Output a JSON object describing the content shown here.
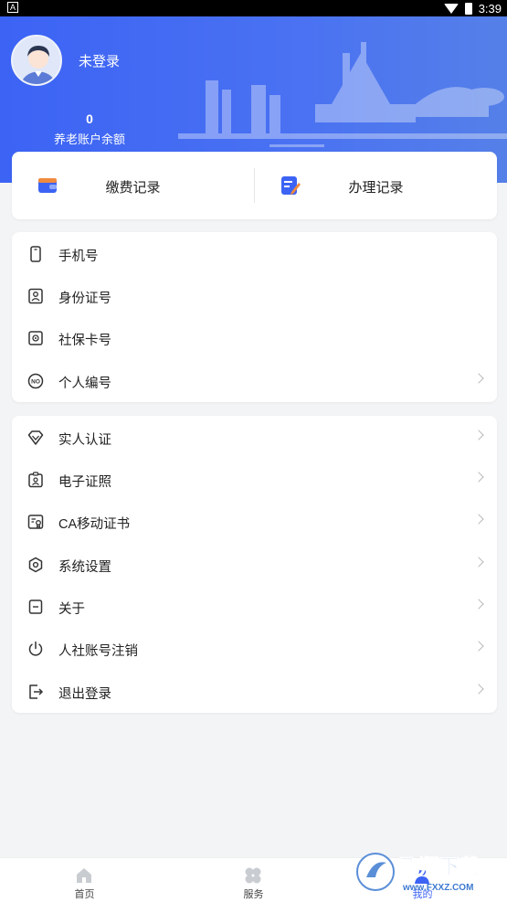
{
  "status_bar": {
    "notification_glyph": "A",
    "time": "3:39"
  },
  "profile": {
    "login_status": "未登录",
    "balance_value": "0",
    "balance_label": "养老账户余额"
  },
  "records": [
    {
      "label": "缴费记录",
      "icon": "wallet-icon"
    },
    {
      "label": "办理记录",
      "icon": "edit-document-icon"
    }
  ],
  "info_list": [
    {
      "label": "手机号",
      "icon": "phone-icon",
      "chevron": false
    },
    {
      "label": "身份证号",
      "icon": "id-card-icon",
      "chevron": false
    },
    {
      "label": "社保卡号",
      "icon": "social-card-icon",
      "chevron": false
    },
    {
      "label": "个人编号",
      "icon": "number-icon",
      "chevron": true
    }
  ],
  "menu_list": [
    {
      "label": "实人认证",
      "icon": "diamond-icon"
    },
    {
      "label": "电子证照",
      "icon": "badge-icon"
    },
    {
      "label": "CA移动证书",
      "icon": "certificate-icon"
    },
    {
      "label": "系统设置",
      "icon": "settings-icon"
    },
    {
      "label": "关于",
      "icon": "info-box-icon"
    },
    {
      "label": "人社账号注销",
      "icon": "power-icon"
    },
    {
      "label": "退出登录",
      "icon": "logout-icon"
    }
  ],
  "tabbar": [
    {
      "label": "首页",
      "icon": "home-icon",
      "active": false
    },
    {
      "label": "服务",
      "icon": "service-icon",
      "active": false
    },
    {
      "label": "我的",
      "icon": "profile-icon",
      "active": true
    }
  ],
  "watermark": {
    "title": "飞翔下载",
    "url": "www.FXXZ.COM"
  },
  "colors": {
    "primary": "#3c63f4",
    "background": "#f3f4f6",
    "card": "#ffffff",
    "text": "#222222",
    "chevron": "#b8b8b8"
  }
}
